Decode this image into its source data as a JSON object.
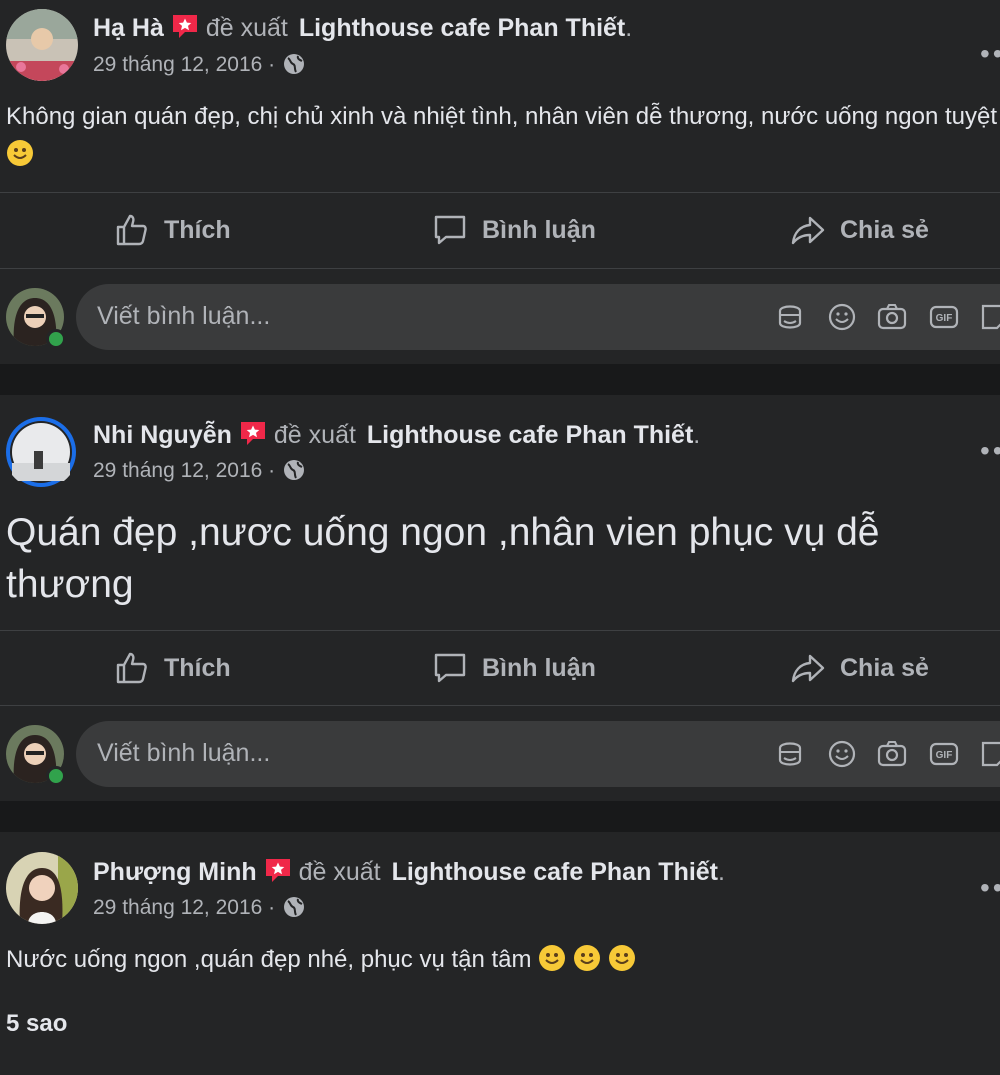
{
  "posts": [
    {
      "author": "Hạ Hà",
      "recommends": "đề xuất",
      "page": "Lighthouse cafe Phan Thiết",
      "date": "29 tháng 12, 2016",
      "dot": "·",
      "text": "Không gian quán đẹp, chị chủ xinh và nhiệt tình, nhân viên dễ thương, nước uống ngon tuyệt",
      "emoji_count": 1
    },
    {
      "author": "Nhi Nguyễn",
      "recommends": "đề xuất",
      "page": "Lighthouse cafe Phan Thiết",
      "date": "29 tháng 12, 2016",
      "dot": "·",
      "text": "Quán đẹp ,nươc uống ngon ,nhân vien phục vụ dễ thương",
      "emoji_count": 0
    },
    {
      "author": "Phượng Minh",
      "recommends": "đề xuất",
      "page": "Lighthouse cafe Phan Thiết",
      "date": "29 tháng 12, 2016",
      "dot": "·",
      "text": "Nước uống ngon ,quán đẹp nhé, phục vụ tận tâm",
      "emoji_count": 3,
      "rating": "5 sao"
    }
  ],
  "actions": {
    "like": "Thích",
    "comment": "Bình luận",
    "share": "Chia sẻ"
  },
  "comment_box": {
    "placeholder": "Viết bình luận..."
  },
  "icons": [
    "like-icon",
    "comment-icon",
    "share-icon",
    "globe-icon",
    "recommend-star-icon",
    "avatar-sticker-icon",
    "emoji-icon",
    "camera-icon",
    "gif-icon",
    "sticker-icon",
    "more-options-icon"
  ],
  "colors": {
    "background": "#18191a",
    "card": "#242526",
    "input": "#3a3b3c",
    "text": "#e4e6eb",
    "secondary": "#b0b3b8",
    "recommend_badge": "#f02849",
    "online": "#31a24c"
  }
}
